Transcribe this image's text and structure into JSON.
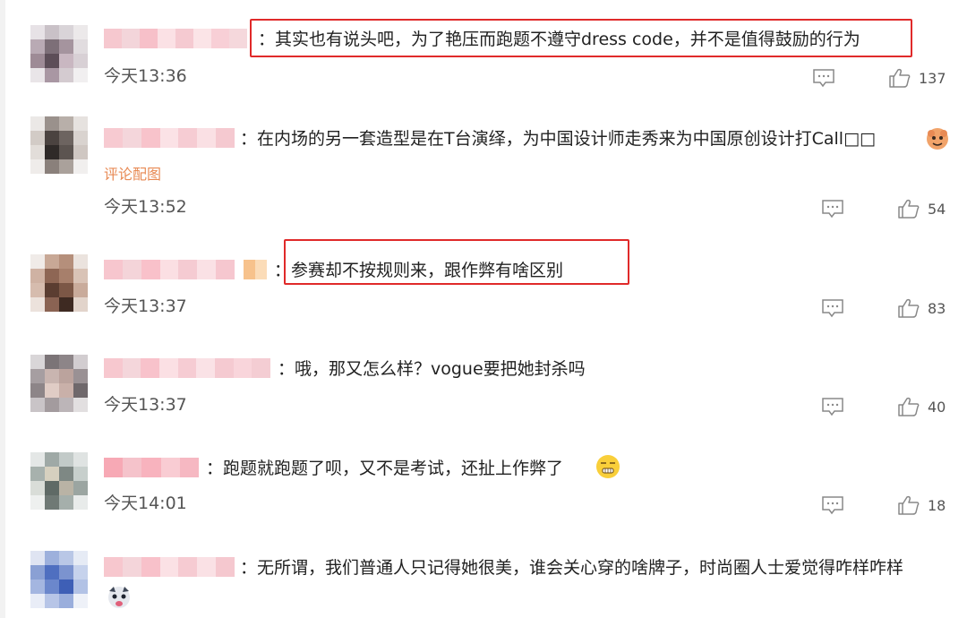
{
  "comments": [
    {
      "text": "：其实也有说头吧，为了艳压而跑题不遵守dress code，并不是值得鼓励的行为",
      "time": "今天13:36",
      "likes": "137"
    },
    {
      "text": "：在内场的另一套造型是在T台演绎，为中国设计师走秀来为中国原创设计打Call□□",
      "extra": "评论配图",
      "time": "今天13:52",
      "likes": "54"
    },
    {
      "text": "：参赛却不按规则来，跟作弊有啥区别",
      "time": "今天13:37",
      "likes": "83"
    },
    {
      "text": "：哦，那又怎么样？vogue要把她封杀吗",
      "time": "今天13:37",
      "likes": "40"
    },
    {
      "text": "：跑题就跑题了呗，又不是考试，还扯上作弊了",
      "time": "今天14:01",
      "likes": "18"
    },
    {
      "text": "：无所谓，我们普通人只记得她很美，谁会关心穿的啥牌子，时尚圈人士爱觉得咋样咋样"
    }
  ],
  "colors": {
    "highlight": "#e02a2a",
    "text": "#222222",
    "meta": "#555555",
    "icon": "#888888"
  },
  "icons": [
    "comment-icon",
    "thumbs-up-icon",
    "emoji-icon"
  ]
}
